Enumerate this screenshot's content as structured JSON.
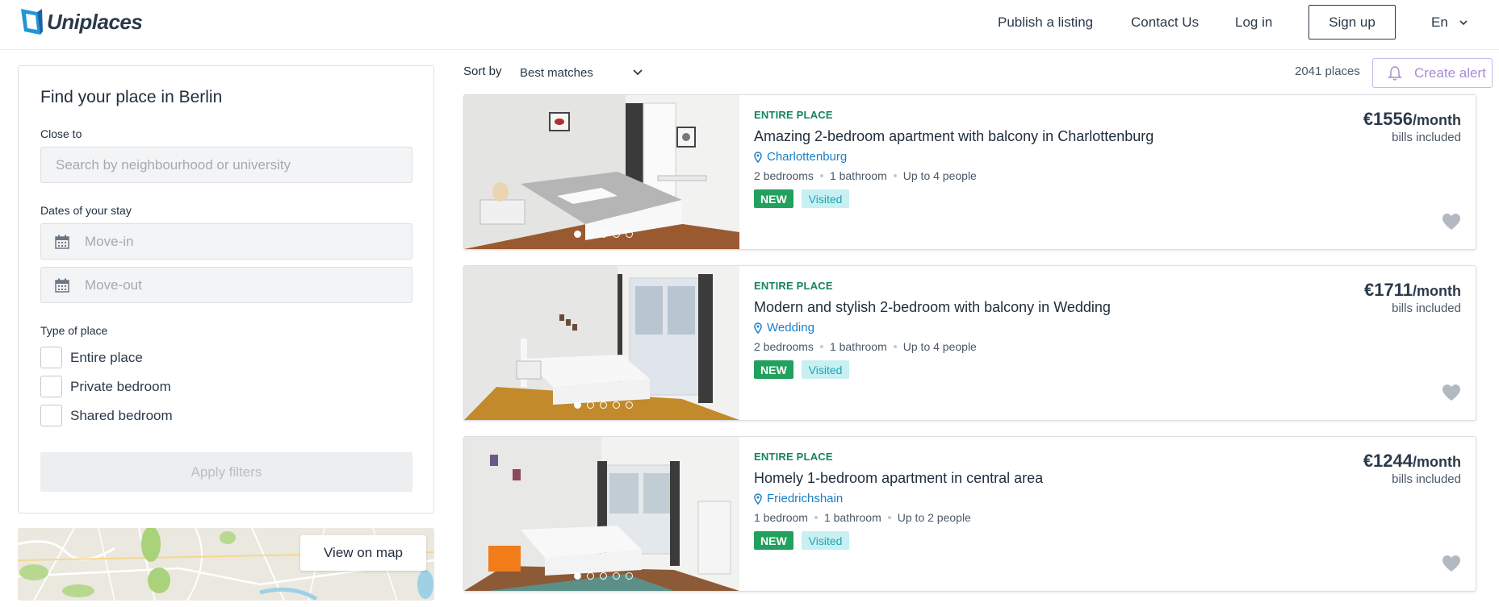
{
  "header": {
    "logo_text": "Uniplaces",
    "nav": {
      "publish": "Publish a listing",
      "contact": "Contact Us",
      "login": "Log in",
      "signup": "Sign up",
      "language": "En"
    }
  },
  "filters": {
    "title": "Find your place in Berlin",
    "close_to_label": "Close to",
    "search_placeholder": "Search by neighbourhood or university",
    "dates_label": "Dates of your stay",
    "move_in_placeholder": "Move-in",
    "move_out_placeholder": "Move-out",
    "type_label": "Type of place",
    "types": [
      {
        "label": "Entire place",
        "checked": false
      },
      {
        "label": "Private bedroom",
        "checked": false
      },
      {
        "label": "Shared bedroom",
        "checked": false
      }
    ],
    "apply_label": "Apply filters"
  },
  "map": {
    "button_label": "View on map"
  },
  "sort": {
    "label": "Sort by",
    "selected": "Best matches"
  },
  "results": {
    "count": "2041 places",
    "alert_label": "Create alert"
  },
  "listings": [
    {
      "type": "ENTIRE PLACE",
      "title": "Amazing 2-bedroom apartment with balcony in Charlottenburg",
      "location": "Charlottenburg",
      "bedrooms": "2 bedrooms",
      "bathrooms": "1 bathroom",
      "people": "Up to 4 people",
      "badge_new": "NEW",
      "badge_visited": "Visited",
      "price": "€1556",
      "per": "/month",
      "bills": "bills included"
    },
    {
      "type": "ENTIRE PLACE",
      "title": "Modern and stylish 2-bedroom with balcony in Wedding",
      "location": "Wedding",
      "bedrooms": "2 bedrooms",
      "bathrooms": "1 bathroom",
      "people": "Up to 4 people",
      "badge_new": "NEW",
      "badge_visited": "Visited",
      "price": "€1711",
      "per": "/month",
      "bills": "bills included"
    },
    {
      "type": "ENTIRE PLACE",
      "title": "Homely 1-bedroom apartment in central area",
      "location": "Friedrichshain",
      "bedrooms": "1 bedroom",
      "bathrooms": "1 bathroom",
      "people": "Up to 2 people",
      "badge_new": "NEW",
      "badge_visited": "Visited",
      "price": "€1244",
      "per": "/month",
      "bills": "bills included"
    }
  ],
  "colors": {
    "brand": "#2196d9",
    "text_dark": "#2b3a4a",
    "entire_place_green": "#16845a",
    "new_badge": "#22a05d",
    "visited_badge_bg": "#c8f0f3",
    "location_blue": "#1a7fc4",
    "alert_purple": "#a78bd6"
  },
  "icons": [
    "uniplaces-logo-icon",
    "chevron-down-icon",
    "calendar-icon",
    "bell-icon",
    "location-pin-icon",
    "heart-icon"
  ]
}
